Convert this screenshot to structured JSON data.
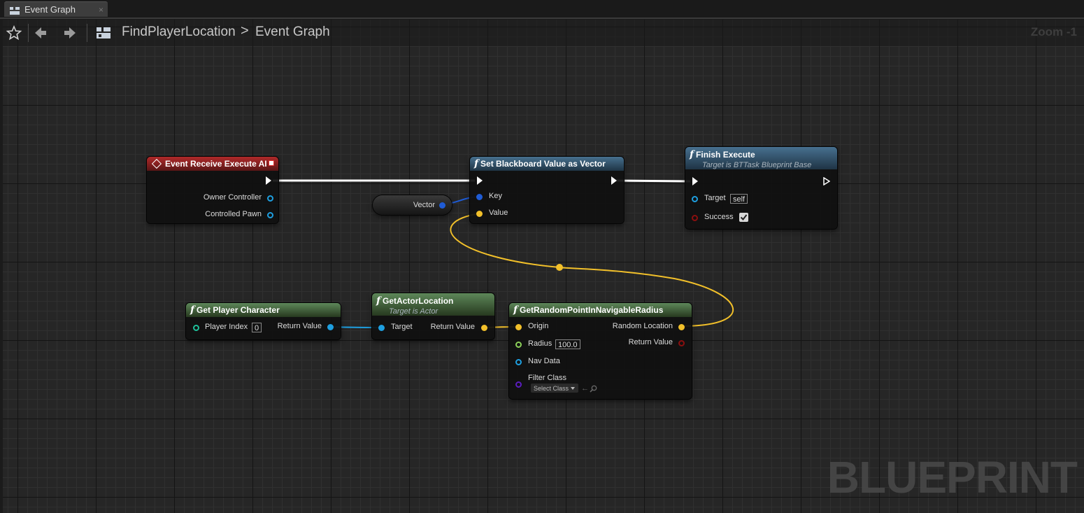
{
  "tab": {
    "label": "Event Graph",
    "close": "×"
  },
  "breadcrumb": {
    "blueprint": "FindPlayerLocation",
    "separator": ">",
    "graph": "Event Graph"
  },
  "zoom": "Zoom -1",
  "watermark": "BLUEPRINT",
  "icons": {
    "favorite": "star-icon",
    "back": "arrow-left-icon",
    "forward": "arrow-right-icon",
    "graph": "blueprint-graph-icon"
  },
  "colors": {
    "exec": "#ffffff",
    "object": "#1e9fe0",
    "vector": "#f2c02a",
    "bool": "#8b0f0f",
    "float": "#8cd15a",
    "struct_key": "#1f5cd6",
    "class": "#5b1dc0",
    "event_header": "#b02a2a",
    "function_header": "#47708f",
    "pure_header": "#5d8759"
  },
  "nodes": {
    "event_receive": {
      "title": "Event Receive Execute AI",
      "pins": {
        "owner": "Owner Controller",
        "pawn": "Controlled Pawn"
      }
    },
    "set_bb": {
      "title": "Set Blackboard Value as Vector",
      "pins": {
        "key": "Key",
        "value": "Value"
      }
    },
    "finish": {
      "title": "Finish Execute",
      "subtitle": "Target is BTTask Blueprint Base",
      "pins": {
        "target": "Target",
        "target_default": "self",
        "success": "Success"
      },
      "success_checked": true
    },
    "vector_var": {
      "label": "Vector"
    },
    "get_player": {
      "title": "Get Player Character",
      "pins": {
        "index": "Player Index",
        "index_default": "0",
        "ret": "Return Value"
      }
    },
    "get_actor_loc": {
      "title": "GetActorLocation",
      "subtitle": "Target is Actor",
      "pins": {
        "target": "Target",
        "ret": "Return Value"
      }
    },
    "random_point": {
      "title": "GetRandomPointInNavigableRadius",
      "pins": {
        "origin": "Origin",
        "radius": "Radius",
        "radius_default": "100.0",
        "nav": "Nav Data",
        "filter": "Filter Class",
        "filter_select": "Select Class",
        "random_loc": "Random Location",
        "ret": "Return Value"
      }
    }
  }
}
